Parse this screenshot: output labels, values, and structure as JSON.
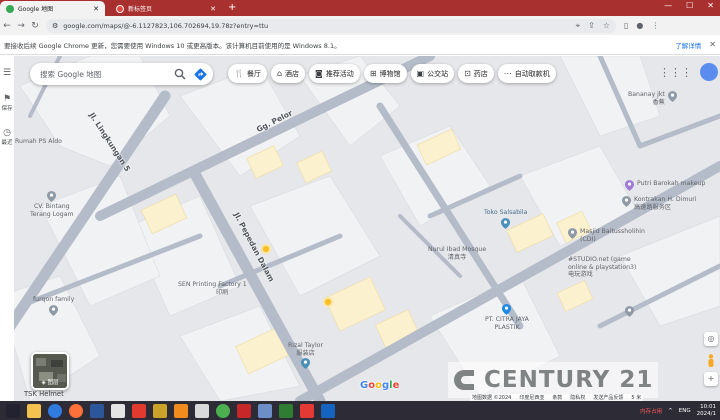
{
  "browser": {
    "tabs": [
      {
        "title": "Google 地图",
        "active": true
      },
      {
        "title": "新标签页",
        "active": false
      }
    ],
    "url": "google.com/maps/@-6.1127823,106.702694,19.78z?entry=ttu",
    "infobar": {
      "message": "要接收后续 Google Chrome 更新，您需要使用 Windows 10 或更高版本。该计算机目前使用的是 Windows 8.1。",
      "link": "了解详情"
    },
    "tab_color": "#a8302f"
  },
  "maps": {
    "search_placeholder": "搜索 Google 地图",
    "rail": [
      {
        "label": "",
        "icon": "menu-icon"
      },
      {
        "label": "保存",
        "icon": "bookmark-icon"
      },
      {
        "label": "最近",
        "icon": "history-icon"
      }
    ],
    "chips": [
      {
        "label": "餐厅",
        "icon": "restaurant-icon"
      },
      {
        "label": "酒店",
        "icon": "hotel-icon"
      },
      {
        "label": "推荐活动",
        "icon": "camera-icon"
      },
      {
        "label": "博物馆",
        "icon": "museum-icon"
      },
      {
        "label": "公交站",
        "icon": "bus-icon"
      },
      {
        "label": "药店",
        "icon": "pharmacy-icon"
      },
      {
        "label": "自动取款机",
        "icon": "more-icon"
      }
    ],
    "roads": [
      "Jl. Lingkungan 5",
      "Gg. Pelor",
      "Jl. Pepedan Dalam"
    ],
    "places": [
      {
        "name": [
          "Bananay jkt",
          "香蕉"
        ],
        "color": "#5f6368"
      },
      {
        "name": [
          "Putri Barokah makeup"
        ],
        "color": "#7e57c2"
      },
      {
        "name": [
          "Kontrakan H. Dimuri",
          "高速路服务区"
        ],
        "color": "#5f6368"
      },
      {
        "name": [
          "Toko Salsabila"
        ],
        "color": "#4a90b8"
      },
      {
        "name": [
          "Masjid Baitussholihin",
          "(CDI)"
        ],
        "color": "#5f6368"
      },
      {
        "name": [
          "Nurul Ibad Mosque",
          "清真寺"
        ],
        "color": "#5f6368"
      },
      {
        "name": [
          "#STUDIO.net (game",
          "online & playstation3)",
          "电玩游戏"
        ],
        "color": "#5f6368"
      },
      {
        "name": [
          "PT. CITRA JAYA",
          "PLASTIK"
        ],
        "color": "#1e88e5"
      },
      {
        "name": [
          "SEN Printing Factory 1",
          "印刷"
        ],
        "color": "#5f6368"
      },
      {
        "name": [
          "Rizal Taylor",
          "服装店"
        ],
        "color": "#4a90b8"
      },
      {
        "name": [
          "CV. Bintang",
          "Terang Logam"
        ],
        "color": "#5f6368"
      },
      {
        "name": [
          "furqon family"
        ],
        "color": "#5f6368"
      },
      {
        "name": [
          "Rumah PS Aldo"
        ],
        "color": "#5f6368"
      },
      {
        "name": [
          "TSK Helmet"
        ],
        "color": "#5f6368"
      }
    ],
    "layers_label": "图层",
    "google_logo": [
      "G",
      "o",
      "o",
      "g",
      "l",
      "e"
    ],
    "watermark_text": "CENTURY 21",
    "attribution": [
      "地图数据 ©2024",
      "印度尼西亚",
      "条款",
      "隐私权",
      "发送产品反馈",
      "5 米"
    ]
  },
  "taskbar": {
    "icons": [
      {
        "name": "start-icon",
        "color": "#222230"
      },
      {
        "name": "file-explorer-icon",
        "color": "#f2c14e"
      },
      {
        "name": "edge-icon",
        "color": "#2f7be0"
      },
      {
        "name": "firefox-icon",
        "color": "#ff7139"
      },
      {
        "name": "word-icon",
        "color": "#2b579a"
      },
      {
        "name": "app-icon",
        "color": "#e4e4e4"
      },
      {
        "name": "pdf-icon",
        "color": "#e23a2e"
      },
      {
        "name": "paint-icon",
        "color": "#c9a227"
      },
      {
        "name": "vlc-icon",
        "color": "#f18b1e"
      },
      {
        "name": "app-icon-2",
        "color": "#d9d9d9"
      },
      {
        "name": "chrome-icon",
        "color": "#4caf50"
      },
      {
        "name": "wps-icon",
        "color": "#c62828"
      },
      {
        "name": "app-icon-3",
        "color": "#6d8fc7"
      },
      {
        "name": "app-icon-4",
        "color": "#2e7d32"
      },
      {
        "name": "app-icon-5",
        "color": "#e53935"
      },
      {
        "name": "app-icon-6",
        "color": "#1565c0"
      }
    ],
    "status": "内存占用",
    "lang": "ENG",
    "time": "10:01",
    "date": "2024/1"
  }
}
